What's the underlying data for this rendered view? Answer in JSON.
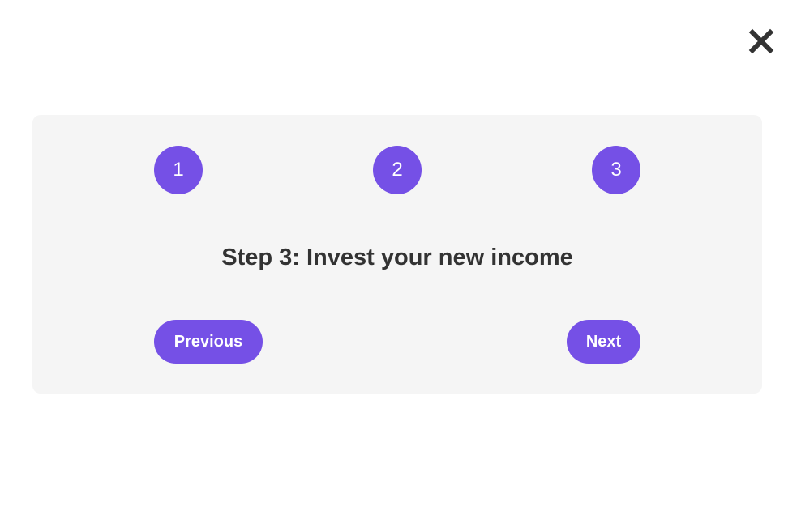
{
  "close": {
    "icon": "close-icon"
  },
  "steps": [
    {
      "number": "1"
    },
    {
      "number": "2"
    },
    {
      "number": "3"
    }
  ],
  "title": "Step 3: Invest your new income",
  "buttons": {
    "previous": "Previous",
    "next": "Next"
  },
  "colors": {
    "accent": "#7550e6",
    "card_background": "#f5f5f5",
    "title_text": "#333333",
    "close_icon": "#333333"
  }
}
